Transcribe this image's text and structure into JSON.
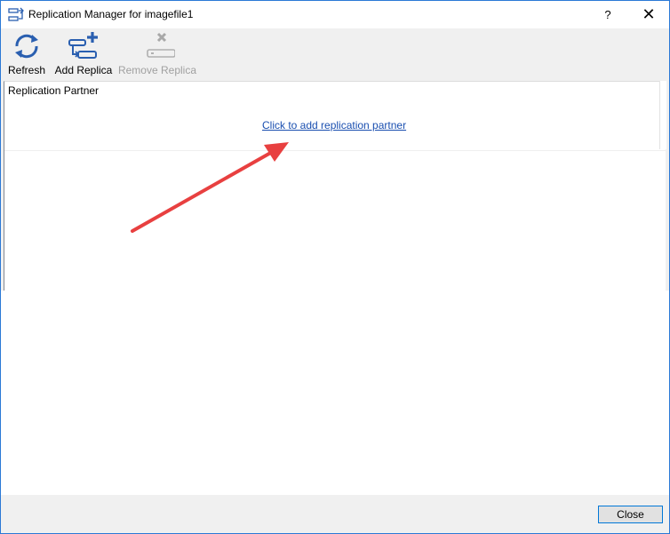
{
  "window": {
    "title": "Replication Manager for imagefile1",
    "help_label": "?",
    "close_label": "✕"
  },
  "toolbar": {
    "refresh_label": "Refresh",
    "add_replica_label": "Add Replica",
    "remove_replica_label": "Remove Replica"
  },
  "panel": {
    "column_header": "Replication Partner",
    "add_partner_link": "Click to add replication partner"
  },
  "footer": {
    "close_button_label": "Close"
  },
  "colors": {
    "accent": "#0078d7",
    "link": "#1a4fb0",
    "icon_blue": "#2a5fb0",
    "annotation_arrow": "#e84040",
    "disabled": "#a0a0a0"
  }
}
